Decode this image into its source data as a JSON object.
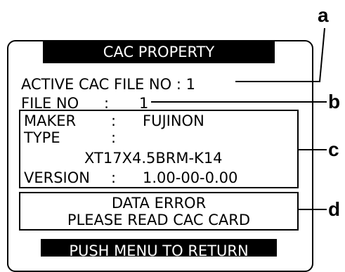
{
  "title": "CAC PROPERTY",
  "active_cac_file": {
    "label": "ACTIVE CAC FILE NO : 1"
  },
  "file_no": {
    "label": "FILE NO",
    "separator": ":",
    "value": "1"
  },
  "lens_info": {
    "maker_label": "MAKER",
    "maker_sep": ":",
    "maker_value": "FUJINON",
    "type_label": "TYPE",
    "type_sep": ":",
    "type_value": "XT17X4.5BRM-K14",
    "version_label": "VERSION",
    "version_sep": ":",
    "version_value": "1.00-00-0.00"
  },
  "message": {
    "line1": "DATA ERROR",
    "line2": "PLEASE READ CAC CARD"
  },
  "footer": "PUSH  MENU  TO  RETURN",
  "callouts": {
    "a": "a",
    "b": "b",
    "c": "c",
    "d": "d"
  }
}
